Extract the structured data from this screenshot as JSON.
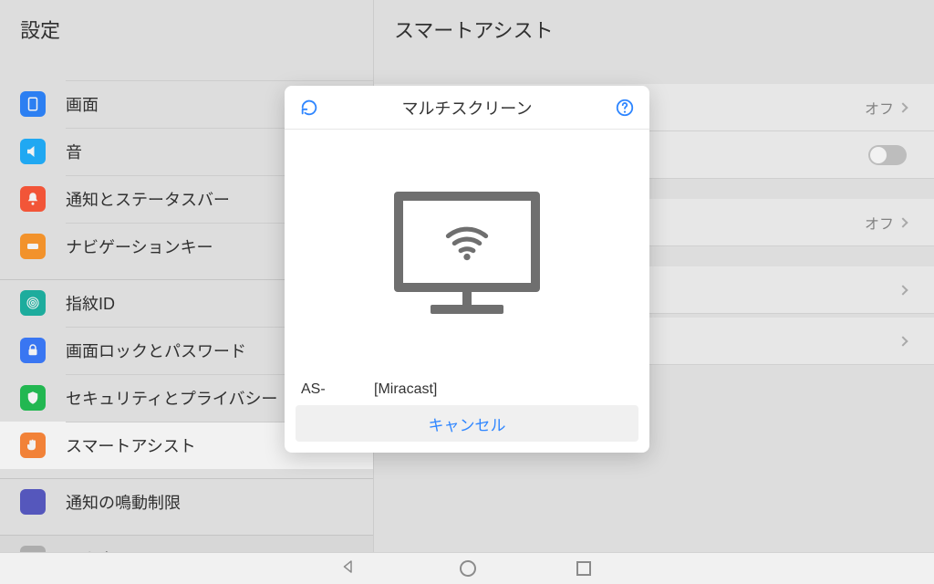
{
  "sidebar": {
    "title": "設定",
    "items": [
      {
        "label": "画面"
      },
      {
        "label": "音"
      },
      {
        "label": "通知とステータスバー"
      },
      {
        "label": "ナビゲーションキー"
      },
      {
        "label": "指紋ID"
      },
      {
        "label": "画面ロックとパスワード"
      },
      {
        "label": "セキュリティとプライバシー"
      },
      {
        "label": "スマートアシスト"
      },
      {
        "label": "通知の鳴動制限"
      },
      {
        "label": "アカウント"
      }
    ]
  },
  "panel": {
    "title": "スマートアシスト",
    "row0_value": "オフ",
    "row2_value": "オフ"
  },
  "dialog": {
    "title": "マルチスクリーン",
    "device": "AS-            [Miracast]",
    "cancel": "キャンセル"
  }
}
